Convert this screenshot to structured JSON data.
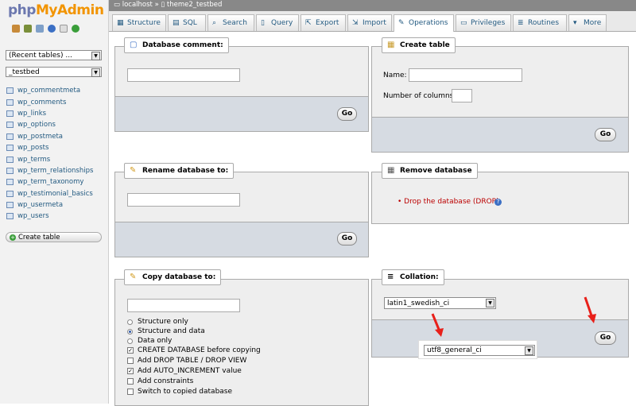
{
  "sidebar": {
    "logo_php": "php",
    "logo_myadmin": "MyAdmin",
    "quick_icons": [
      "home-icon",
      "exit-icon",
      "query-window-icon",
      "docs-icon",
      "sql-docs-icon",
      "reload-icon"
    ],
    "recent_select": "(Recent tables) ...",
    "db_select": "_testbed",
    "tables": [
      "wp_commentmeta",
      "wp_comments",
      "wp_links",
      "wp_options",
      "wp_postmeta",
      "wp_posts",
      "wp_terms",
      "wp_term_relationships",
      "wp_term_taxonomy",
      "wp_testimonial_basics",
      "wp_usermeta",
      "wp_users"
    ],
    "create_table": "Create table"
  },
  "breadcrumb": {
    "server": "localhost",
    "sep": "»",
    "database": "theme2_testbed"
  },
  "tabs": [
    {
      "label": "Structure",
      "icon": "structure-icon"
    },
    {
      "label": "SQL",
      "icon": "sql-icon"
    },
    {
      "label": "Search",
      "icon": "search-icon"
    },
    {
      "label": "Query",
      "icon": "query-icon"
    },
    {
      "label": "Export",
      "icon": "export-icon"
    },
    {
      "label": "Import",
      "icon": "import-icon"
    },
    {
      "label": "Operations",
      "icon": "operations-icon"
    },
    {
      "label": "Privileges",
      "icon": "privileges-icon"
    },
    {
      "label": "Routines",
      "icon": "routines-icon"
    },
    {
      "label": "More",
      "icon": "more-icon"
    }
  ],
  "db_comment": {
    "legend": "Database comment:",
    "value": "",
    "go": "Go"
  },
  "create_table": {
    "legend": "Create table",
    "name_label": "Name:",
    "cols_label": "Number of columns:",
    "name_value": "",
    "cols_value": "",
    "go": "Go"
  },
  "rename": {
    "legend": "Rename database to:",
    "value": "",
    "go": "Go"
  },
  "remove": {
    "legend": "Remove database",
    "drop_link": "Drop the database (DROP)"
  },
  "copy": {
    "legend": "Copy database to:",
    "value": "",
    "radios": [
      {
        "label": "Structure only",
        "checked": false
      },
      {
        "label": "Structure and data",
        "checked": true
      },
      {
        "label": "Data only",
        "checked": false
      }
    ],
    "checkboxes": [
      {
        "label": "CREATE DATABASE before copying",
        "checked": true
      },
      {
        "label": "Add DROP TABLE / DROP VIEW",
        "checked": false
      },
      {
        "label": "Add AUTO_INCREMENT value",
        "checked": true
      },
      {
        "label": "Add constraints",
        "checked": false
      },
      {
        "label": "Switch to copied database",
        "checked": false
      }
    ]
  },
  "collation": {
    "legend": "Collation:",
    "current": "latin1_swedish_ci",
    "dropdown_option": "utf8_general_ci",
    "go": "Go"
  },
  "colors": {
    "accent_red": "#e8201a",
    "link_blue": "#235a81",
    "drop_red": "#bb0000"
  }
}
